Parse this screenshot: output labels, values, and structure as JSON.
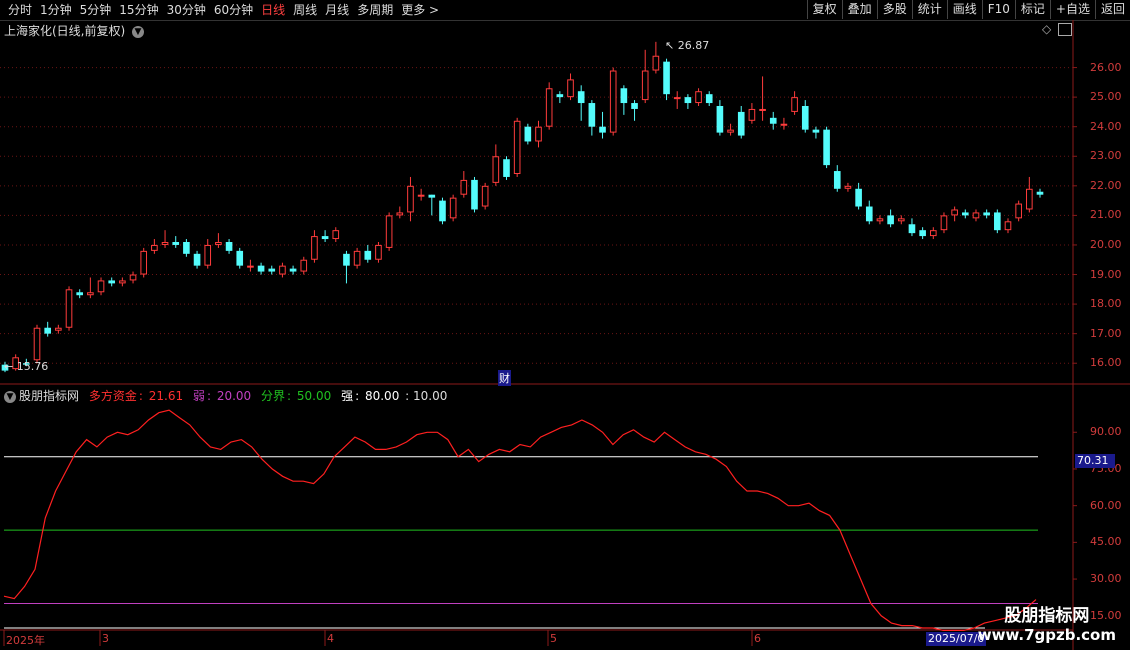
{
  "toolbar": {
    "periods": [
      "分时",
      "1分钟",
      "5分钟",
      "15分钟",
      "30分钟",
      "60分钟",
      "日线",
      "周线",
      "月线",
      "多周期",
      "更多 >"
    ],
    "active_period": "日线",
    "buttons": [
      "复权",
      "叠加",
      "多股",
      "统计",
      "画线",
      "F10",
      "标记",
      "+自选",
      "返回"
    ]
  },
  "chart": {
    "title": "上海家化(日线,前复权)",
    "high_label": "26.87",
    "low_label": "15.76",
    "cai_label": "财",
    "price_ticks": [
      "26.00",
      "25.00",
      "24.00",
      "23.00",
      "22.00",
      "21.00",
      "20.00",
      "19.00",
      "18.00",
      "17.00",
      "16.00"
    ]
  },
  "indicator": {
    "name": "股朋指标网",
    "duofang_label": "多方资金",
    "duofang_value": "21.61",
    "ruo_label": "弱",
    "ruo_value": "20.00",
    "fenjie_label": "分界",
    "fenjie_value": "50.00",
    "qiang_label": "强",
    "qiang_value": "80.00",
    "extra_value": ": 10.00",
    "ticks": [
      "90.00",
      "75.00",
      "60.00",
      "45.00",
      "30.00",
      "15.00"
    ],
    "current_value": "70.31"
  },
  "dates": {
    "labels": [
      "2025年",
      "3",
      "4",
      "5",
      "6"
    ],
    "current": "2025/07/0"
  },
  "watermark": {
    "title": "股朋指标网",
    "url": "www.7gpzb.com"
  },
  "colors": {
    "up": "#ff3c3c",
    "down": "#54fcfc",
    "indicator_line": "#ff2020",
    "strong": "#ffffff",
    "mid": "#20c020",
    "weak": "#c040c0"
  },
  "chart_data": {
    "type": "candlestick",
    "title": "上海家化(日线,前复权)",
    "ylim": [
      15.5,
      27.0
    ],
    "candles": [
      [
        15.95,
        15.75,
        16.05,
        15.7
      ],
      [
        15.8,
        16.2,
        16.3,
        15.75
      ],
      [
        16.0,
        15.95,
        16.15,
        15.9
      ],
      [
        16.1,
        17.2,
        17.3,
        16.0
      ],
      [
        17.2,
        17.0,
        17.4,
        16.9
      ],
      [
        17.1,
        17.2,
        17.3,
        17.0
      ],
      [
        17.2,
        18.5,
        18.6,
        17.1
      ],
      [
        18.4,
        18.3,
        18.5,
        18.2
      ],
      [
        18.3,
        18.4,
        18.9,
        18.2
      ],
      [
        18.4,
        18.8,
        18.9,
        18.3
      ],
      [
        18.8,
        18.7,
        18.9,
        18.6
      ],
      [
        18.7,
        18.8,
        18.9,
        18.6
      ],
      [
        18.8,
        19.0,
        19.1,
        18.7
      ],
      [
        19.0,
        19.8,
        19.9,
        18.9
      ],
      [
        19.8,
        20.0,
        20.2,
        19.7
      ],
      [
        20.0,
        20.1,
        20.5,
        19.9
      ],
      [
        20.1,
        20.0,
        20.3,
        19.9
      ],
      [
        20.1,
        19.7,
        20.2,
        19.6
      ],
      [
        19.7,
        19.3,
        19.8,
        19.2
      ],
      [
        19.3,
        20.0,
        20.2,
        19.2
      ],
      [
        20.0,
        20.1,
        20.4,
        19.9
      ],
      [
        20.1,
        19.8,
        20.2,
        19.7
      ],
      [
        19.8,
        19.3,
        19.9,
        19.2
      ],
      [
        19.3,
        19.3,
        19.5,
        19.1
      ],
      [
        19.3,
        19.1,
        19.4,
        19.0
      ],
      [
        19.2,
        19.1,
        19.3,
        19.0
      ],
      [
        19.0,
        19.3,
        19.4,
        18.9
      ],
      [
        19.2,
        19.1,
        19.3,
        19.0
      ],
      [
        19.1,
        19.5,
        19.6,
        19.0
      ],
      [
        19.5,
        20.3,
        20.5,
        19.4
      ],
      [
        20.3,
        20.2,
        20.5,
        20.1
      ],
      [
        20.2,
        20.5,
        20.6,
        20.1
      ],
      [
        19.7,
        19.3,
        19.8,
        18.7
      ],
      [
        19.3,
        19.8,
        19.9,
        19.2
      ],
      [
        19.8,
        19.5,
        20.0,
        19.4
      ],
      [
        19.5,
        20.0,
        20.1,
        19.4
      ],
      [
        19.9,
        21.0,
        21.1,
        19.8
      ],
      [
        21.0,
        21.1,
        21.3,
        20.9
      ],
      [
        21.1,
        22.0,
        22.3,
        20.8
      ],
      [
        21.7,
        21.7,
        21.9,
        21.5
      ],
      [
        21.7,
        21.6,
        21.7,
        21.0
      ],
      [
        21.5,
        20.8,
        21.6,
        20.7
      ],
      [
        20.9,
        21.6,
        21.7,
        20.8
      ],
      [
        21.7,
        22.2,
        22.5,
        21.6
      ],
      [
        22.2,
        21.2,
        22.3,
        21.1
      ],
      [
        21.3,
        22.0,
        22.1,
        21.2
      ],
      [
        22.1,
        23.0,
        23.4,
        22.0
      ],
      [
        22.9,
        22.3,
        23.0,
        22.2
      ],
      [
        22.4,
        24.2,
        24.3,
        22.3
      ],
      [
        24.0,
        23.5,
        24.1,
        23.4
      ],
      [
        23.5,
        24.0,
        24.2,
        23.3
      ],
      [
        24.0,
        25.3,
        25.5,
        23.9
      ],
      [
        25.1,
        25.0,
        25.2,
        24.8
      ],
      [
        25.0,
        25.6,
        25.8,
        24.9
      ],
      [
        25.2,
        24.8,
        25.4,
        24.2
      ],
      [
        24.8,
        24.0,
        24.9,
        23.7
      ],
      [
        24.0,
        23.8,
        24.5,
        23.6
      ],
      [
        23.8,
        25.9,
        26.0,
        23.7
      ],
      [
        25.3,
        24.8,
        25.4,
        24.4
      ],
      [
        24.8,
        24.6,
        24.9,
        24.2
      ],
      [
        24.9,
        25.9,
        26.6,
        24.8
      ],
      [
        25.9,
        26.4,
        26.87,
        25.8
      ],
      [
        26.2,
        25.1,
        26.3,
        24.9
      ],
      [
        25.0,
        25.0,
        25.2,
        24.6
      ],
      [
        25.0,
        24.8,
        25.1,
        24.6
      ],
      [
        24.8,
        25.2,
        25.3,
        24.7
      ],
      [
        25.1,
        24.8,
        25.2,
        24.7
      ],
      [
        24.7,
        23.8,
        24.9,
        23.7
      ],
      [
        23.8,
        23.9,
        24.1,
        23.7
      ],
      [
        24.5,
        23.7,
        24.7,
        23.6
      ],
      [
        24.2,
        24.6,
        24.8,
        24.1
      ],
      [
        24.6,
        24.6,
        25.7,
        24.2
      ],
      [
        24.3,
        24.1,
        24.5,
        23.9
      ],
      [
        24.1,
        24.1,
        24.3,
        23.9
      ],
      [
        24.5,
        25.0,
        25.2,
        24.4
      ],
      [
        24.7,
        23.9,
        24.9,
        23.8
      ],
      [
        23.9,
        23.8,
        24.0,
        23.6
      ],
      [
        23.9,
        22.7,
        24.0,
        22.6
      ],
      [
        22.5,
        21.9,
        22.7,
        21.8
      ],
      [
        21.9,
        22.0,
        22.1,
        21.8
      ],
      [
        21.9,
        21.3,
        22.1,
        21.2
      ],
      [
        21.3,
        20.8,
        21.5,
        20.7
      ],
      [
        20.8,
        20.9,
        21.0,
        20.7
      ],
      [
        21.0,
        20.7,
        21.2,
        20.6
      ],
      [
        20.8,
        20.9,
        21.0,
        20.7
      ],
      [
        20.7,
        20.4,
        20.9,
        20.3
      ],
      [
        20.5,
        20.3,
        20.6,
        20.2
      ],
      [
        20.3,
        20.5,
        20.6,
        20.2
      ],
      [
        20.5,
        21.0,
        21.1,
        20.4
      ],
      [
        21.0,
        21.2,
        21.3,
        20.8
      ],
      [
        21.1,
        21.0,
        21.2,
        20.9
      ],
      [
        20.9,
        21.1,
        21.2,
        20.8
      ],
      [
        21.1,
        21.0,
        21.2,
        20.9
      ],
      [
        21.1,
        20.5,
        21.2,
        20.4
      ],
      [
        20.5,
        20.8,
        20.9,
        20.4
      ],
      [
        20.9,
        21.4,
        21.5,
        20.8
      ],
      [
        21.2,
        21.9,
        22.3,
        21.1
      ],
      [
        21.8,
        21.7,
        21.9,
        21.6
      ]
    ],
    "indicator": {
      "name": "多方资金",
      "ylim": [
        10,
        104
      ],
      "values": [
        23,
        22,
        27,
        34,
        55,
        66,
        74,
        82,
        87,
        84,
        88,
        90,
        89,
        91,
        95,
        98,
        99,
        96,
        93,
        88,
        84,
        83,
        86,
        87,
        84,
        79,
        75,
        72,
        70,
        70,
        69,
        73,
        80,
        84,
        88,
        86,
        83,
        83,
        84,
        86,
        89,
        90,
        90,
        87,
        80,
        83,
        78,
        81,
        83,
        82,
        85,
        84,
        88,
        90,
        92,
        93,
        95,
        93,
        90,
        85,
        89,
        91,
        88,
        86,
        90,
        87,
        84,
        82,
        81,
        79,
        76,
        70,
        66,
        66,
        65,
        63,
        60,
        60,
        61,
        58,
        56,
        50,
        40,
        30,
        20,
        15,
        12,
        11,
        11,
        10,
        10,
        9,
        9,
        9,
        10,
        12,
        13,
        14,
        15,
        18,
        21.61
      ],
      "strong": 80,
      "mid": 50,
      "weak": 20,
      "low": 10
    }
  }
}
